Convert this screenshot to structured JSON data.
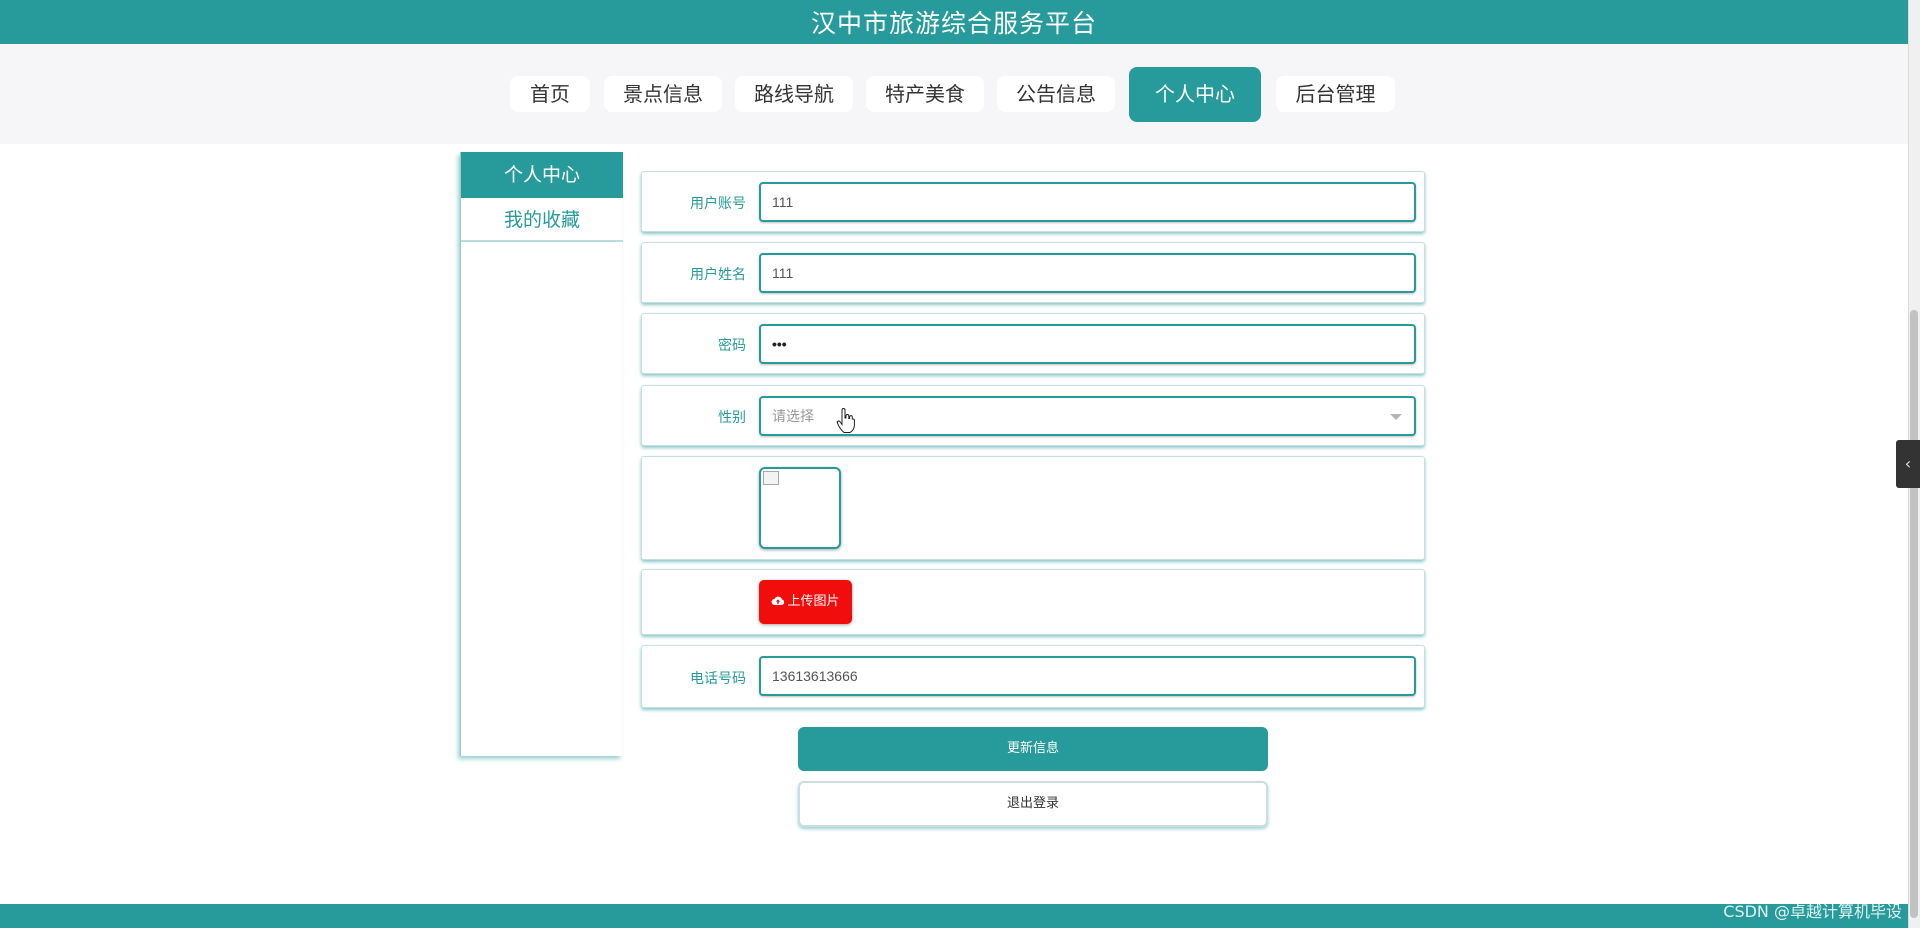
{
  "header": {
    "title": "汉中市旅游综合服务平台"
  },
  "nav": {
    "items": [
      {
        "label": "首页",
        "active": false
      },
      {
        "label": "景点信息",
        "active": false
      },
      {
        "label": "路线导航",
        "active": false
      },
      {
        "label": "特产美食",
        "active": false
      },
      {
        "label": "公告信息",
        "active": false
      },
      {
        "label": "个人中心",
        "active": true
      },
      {
        "label": "后台管理",
        "active": false
      }
    ]
  },
  "sidebar": {
    "heading": "个人中心",
    "items": [
      {
        "label": "我的收藏"
      }
    ]
  },
  "form": {
    "account": {
      "label": "用户账号",
      "value": "111"
    },
    "name": {
      "label": "用户姓名",
      "value": "111"
    },
    "password": {
      "label": "密码",
      "value": "•••"
    },
    "gender": {
      "label": "性别",
      "placeholder": "请选择"
    },
    "upload": {
      "label": "上传图片"
    },
    "phone": {
      "label": "电话号码",
      "value": "13613613666"
    }
  },
  "actions": {
    "update": "更新信息",
    "logout": "退出登录"
  },
  "watermark": "CSDN @卓越计算机毕设",
  "colors": {
    "primary": "#279b9b",
    "upload": "#f20d0d"
  }
}
